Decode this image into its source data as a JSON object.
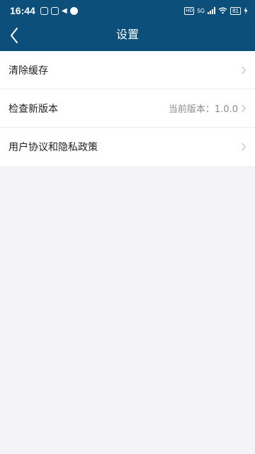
{
  "status_bar": {
    "time": "16:44",
    "hd": "HD",
    "network": "5G",
    "battery": "81"
  },
  "header": {
    "title": "设置"
  },
  "settings": {
    "items": [
      {
        "label": "清除缓存",
        "value": ""
      },
      {
        "label": "检查新版本",
        "value": "当前版本：1.0.0"
      },
      {
        "label": "用户协议和隐私政策",
        "value": ""
      }
    ]
  },
  "colors": {
    "header_bg": "#0b4f7a",
    "page_bg": "#f4f4f6"
  },
  "icons": {
    "back": "chevron-left-icon",
    "row_arrow": "chevron-right-icon"
  }
}
